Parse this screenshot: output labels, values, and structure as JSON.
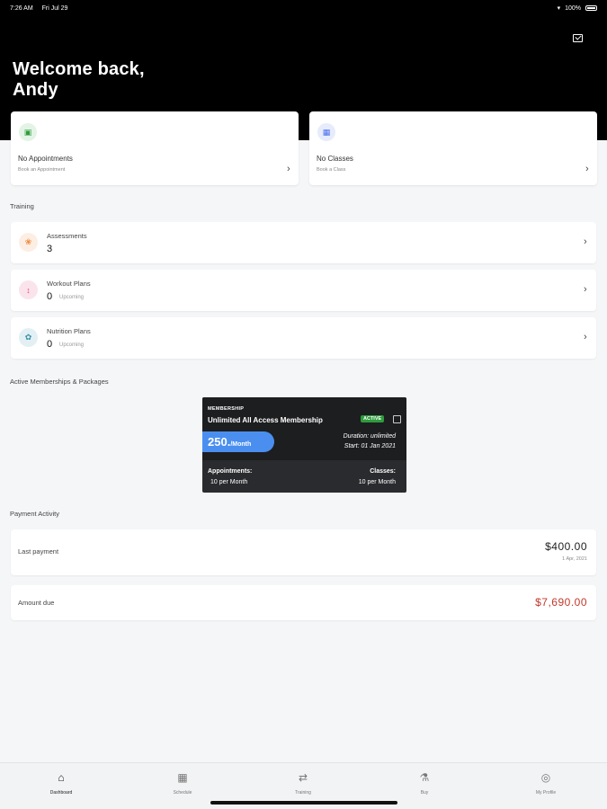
{
  "status": {
    "time": "7:26 AM",
    "date": "Fri Jul 29",
    "battery": "100%"
  },
  "header": {
    "greeting_line1": "Welcome back,",
    "greeting_line2": "Andy"
  },
  "cards": {
    "appointments": {
      "title": "No Appointments",
      "subtitle": "Book an Appointment",
      "icon": "calendar-icon",
      "color": "#2e9c3c"
    },
    "classes": {
      "title": "No Classes",
      "subtitle": "Book a Class",
      "icon": "class-icon",
      "color": "#4a6ff0"
    }
  },
  "training": {
    "label": "Training",
    "items": [
      {
        "name": "Assessments",
        "count": "3",
        "upcoming": "",
        "icon": "paw-icon",
        "color": "#f08a3c"
      },
      {
        "name": "Workout Plans",
        "count": "0",
        "upcoming": "Upcoming",
        "icon": "dumbbell-icon",
        "color": "#e04a7a"
      },
      {
        "name": "Nutrition Plans",
        "count": "0",
        "upcoming": "Upcoming",
        "icon": "apple-icon",
        "color": "#3a8fa8"
      }
    ]
  },
  "memberships": {
    "label": "Active Memberships & Packages",
    "card": {
      "type": "MEMBERSHIP",
      "name": "Unlimited All Access Membership",
      "status": "ACTIVE",
      "price": "250.",
      "period": "/Month",
      "duration": "Duration: unlimited",
      "start": "Start: 01 Jan 2021",
      "appointments_label": "Appointments:",
      "appointments_value": "10 per Month",
      "classes_label": "Classes:",
      "classes_value": "10 per Month"
    }
  },
  "payments": {
    "label": "Payment Activity",
    "last": {
      "label": "Last payment",
      "amount": "$400.00",
      "date": "1 Apr, 2021"
    },
    "due": {
      "label": "Amount due",
      "amount": "$7,690.00",
      "color": "#c0392b"
    }
  },
  "tabs": [
    {
      "label": "Dashboard",
      "icon": "home-icon",
      "active": true
    },
    {
      "label": "Schedule",
      "icon": "calendar-icon",
      "active": false
    },
    {
      "label": "Training",
      "icon": "arrows-icon",
      "active": false
    },
    {
      "label": "Buy",
      "icon": "cart-icon",
      "active": false
    },
    {
      "label": "My Profile",
      "icon": "profile-icon",
      "active": false
    }
  ]
}
